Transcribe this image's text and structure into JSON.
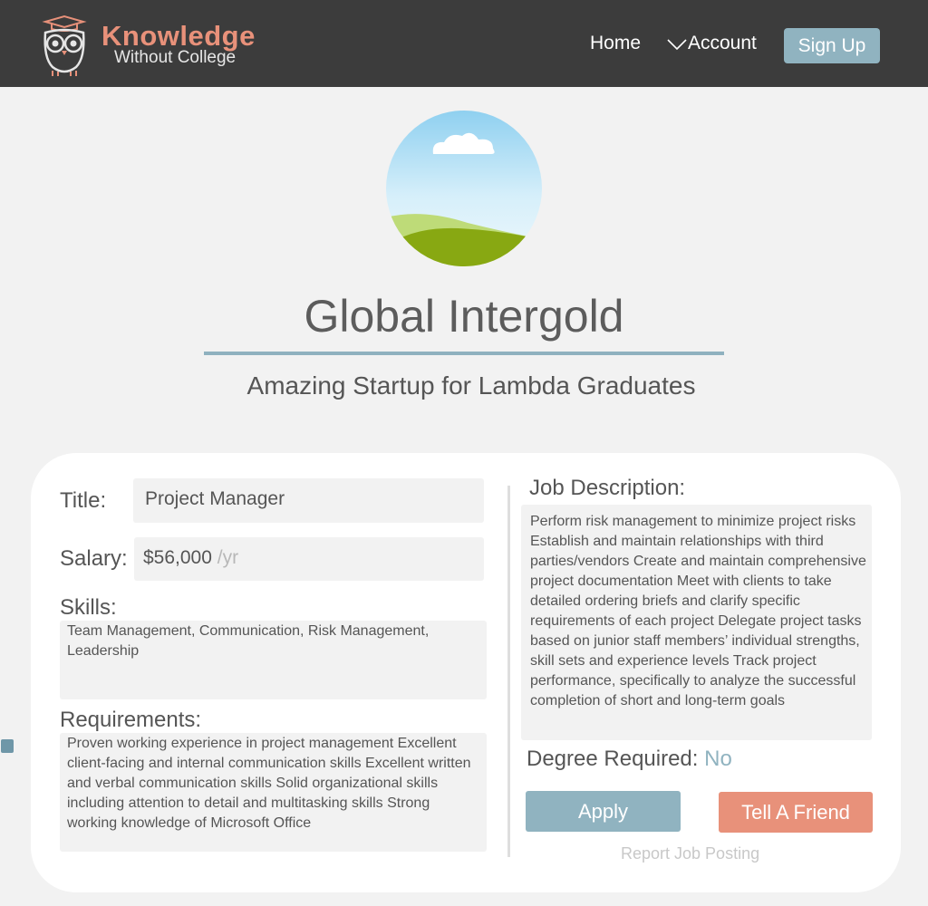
{
  "header": {
    "logo_title": "Knowledge",
    "logo_subtitle": "Without College",
    "nav": {
      "home": "Home",
      "account": "Account"
    },
    "signup_label": "Sign Up"
  },
  "company": {
    "name": "Global Intergold",
    "tagline": "Amazing Startup for Lambda Graduates"
  },
  "job": {
    "title_label": "Title:",
    "title_value": "Project Manager",
    "salary_label": "Salary:",
    "salary_value": "$56,000",
    "salary_unit": "/yr",
    "skills_label": "Skills:",
    "skills_value": "Team Management, Communication, Risk Management, Leadership",
    "requirements_label": "Requirements:",
    "requirements_value": "Proven working experience in project management Excellent client-facing and internal communication skills Excellent written and verbal communication skills Solid organizational skills including attention to detail and multitasking skills Strong working knowledge of Microsoft Office",
    "description_label": "Job Description:",
    "description_value": "Perform risk management to minimize project risks Establish and maintain relationships with third parties/vendors Create and maintain comprehensive project documentation Meet with clients to take detailed ordering briefs and clarify specific requirements of each project Delegate project tasks based on junior staff members’ individual strengths, skill sets and experience levels Track project performance, specifically to analyze the successful completion of short and long-term goals",
    "degree_label": "Degree Required:",
    "degree_value": "No"
  },
  "actions": {
    "apply": "Apply",
    "tell_friend": "Tell A Friend",
    "report": "Report Job Posting"
  },
  "icons": {
    "logo": "owl-graduate-icon",
    "account": "chevron-down-icon",
    "avatar": "landscape-placeholder-icon"
  },
  "colors": {
    "header_bg": "#3c3c3c",
    "accent_blue": "#90b3c0",
    "accent_salmon": "#e8917a",
    "page_bg": "#f2f2f2"
  }
}
